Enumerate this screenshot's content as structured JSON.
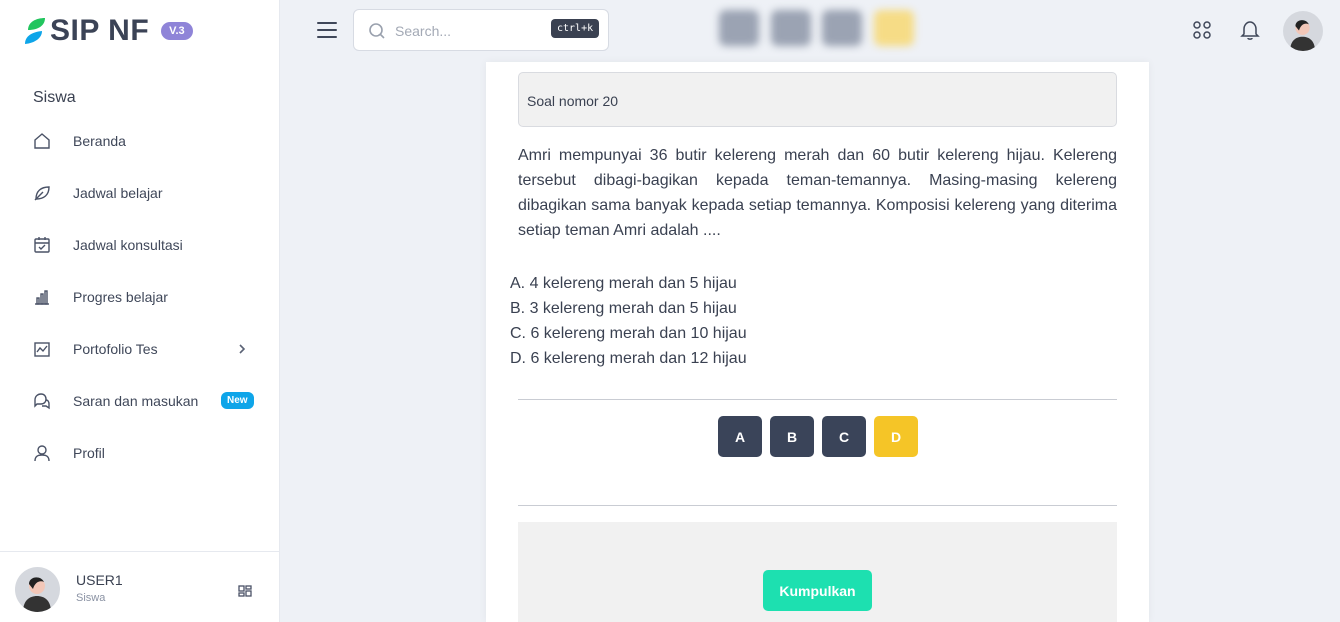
{
  "app": {
    "logo_text": "SIP NF",
    "version": "V.3"
  },
  "sidebar": {
    "section": "Siswa",
    "items": [
      {
        "label": "Beranda",
        "icon": "home-icon"
      },
      {
        "label": "Jadwal belajar",
        "icon": "leaf-icon"
      },
      {
        "label": "Jadwal konsultasi",
        "icon": "calendar-icon"
      },
      {
        "label": "Progres belajar",
        "icon": "bar-chart-icon"
      },
      {
        "label": "Portofolio Tes",
        "icon": "line-chart-icon",
        "has_submenu": true
      },
      {
        "label": "Saran dan masukan",
        "icon": "chat-icon",
        "badge": "New"
      },
      {
        "label": "Profil",
        "icon": "user-icon"
      }
    ],
    "user": {
      "name": "USER1",
      "role": "Siswa"
    }
  },
  "topbar": {
    "search_placeholder": "Search...",
    "search_shortcut": "ctrl+k",
    "icons": [
      "menu-icon",
      "search-icon",
      "apps-icon",
      "bell-icon",
      "avatar"
    ]
  },
  "question": {
    "header": "Soal nomor 20",
    "text": "Amri mempunyai 36 butir kelereng merah dan 60 butir kelereng hijau. Kelereng tersebut dibagi-bagikan kepada teman-temannya. Masing-masing kelereng dibagikan sama banyak kepada setiap temannya. Komposisi kelereng yang diterima setiap teman Amri adalah ....",
    "options": [
      "A. 4 kelereng merah dan 5 hijau",
      "B. 3 kelereng merah dan 5 hijau",
      "C. 6 kelereng merah dan 10 hijau",
      "D. 6 kelereng merah dan 12 hijau"
    ],
    "answer_buttons": [
      "A",
      "B",
      "C",
      "D"
    ],
    "selected": "D"
  },
  "submit_label": "Kumpulkan",
  "colors": {
    "accent_dark": "#3a4459",
    "selected": "#f5c527",
    "submit": "#1de0b0",
    "badge_new": "#0ea5e9",
    "version_badge": "#8f84d8"
  }
}
